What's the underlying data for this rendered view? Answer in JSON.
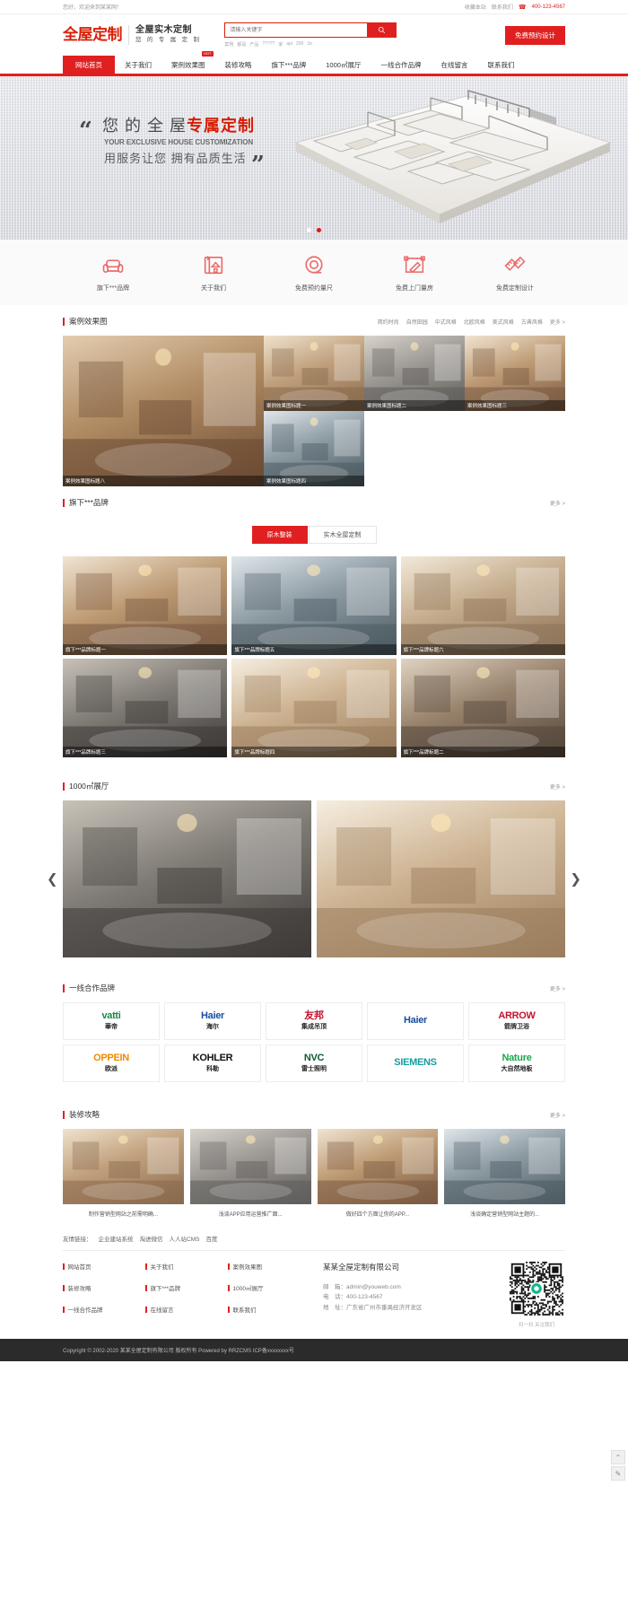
{
  "topbar": {
    "greeting": "您好，欢迎来到某某网！",
    "links": [
      "收藏本站",
      "联系我们"
    ],
    "phone_icon": "telephone-icon",
    "phone": "400-123-4567"
  },
  "header": {
    "logo_mark": "全屋定制",
    "logo_line1": "全屋实木定制",
    "logo_line2": "您 的 专 属 定 制",
    "search_placeholder": "请输入关键字",
    "search_icon": "search-icon",
    "hot_words": [
      "案例",
      "都是",
      "产品",
      "?????",
      "家",
      "api",
      "200",
      "1b"
    ],
    "cta_label": "免费预约设计"
  },
  "nav": {
    "items": [
      {
        "label": "网站首页",
        "active": true,
        "badge": ""
      },
      {
        "label": "关于我们",
        "active": false,
        "badge": ""
      },
      {
        "label": "案例效果图",
        "active": false,
        "badge": "HOT"
      },
      {
        "label": "装修攻略",
        "active": false,
        "badge": ""
      },
      {
        "label": "旗下***品牌",
        "active": false,
        "badge": ""
      },
      {
        "label": "1000㎡展厅",
        "active": false,
        "badge": ""
      },
      {
        "label": "一线合作品牌",
        "active": false,
        "badge": ""
      },
      {
        "label": "在线留言",
        "active": false,
        "badge": ""
      },
      {
        "label": "联系我们",
        "active": false,
        "badge": ""
      }
    ]
  },
  "banner": {
    "quote_open": "“",
    "quote_close": "”",
    "line1_prefix": "您 的 全 屋",
    "line1_accent": "专属定制",
    "line2": "YOUR EXCLUSIVE HOUSE CUSTOMIZATION",
    "line3": "用服务让您 拥有品质生活",
    "dots": [
      false,
      true
    ]
  },
  "features": [
    {
      "icon": "sofa-icon",
      "label": "旗下***品牌"
    },
    {
      "icon": "blueprint-icon",
      "label": "关于我们"
    },
    {
      "icon": "tape-measure-icon",
      "label": "免费预约量尺"
    },
    {
      "icon": "floorplan-ruler-icon",
      "label": "免费上门量房"
    },
    {
      "icon": "pencil-ruler-icon",
      "label": "免费定制设计"
    }
  ],
  "cases": {
    "title": "案例效果图",
    "filters": [
      "简约时尚",
      "自然田园",
      "中式风格",
      "北欧风格",
      "美式风格",
      "古典风格"
    ],
    "more": "更多 >",
    "items": [
      {
        "caption": "案例效果图标题八",
        "big": true
      },
      {
        "caption": "案例效果图标题一",
        "big": false
      },
      {
        "caption": "案例效果图标题二",
        "big": false
      },
      {
        "caption": "案例效果图标题三",
        "big": false
      },
      {
        "caption": "案例效果图标题四",
        "big": false
      }
    ]
  },
  "brands": {
    "title": "旗下***品牌",
    "more": "更多 >",
    "tabs": [
      {
        "label": "原木整装",
        "active": true
      },
      {
        "label": "实木全屋定制",
        "active": false
      }
    ],
    "items": [
      {
        "caption": "旗下***品牌标题一"
      },
      {
        "caption": "旗下***品牌标题五"
      },
      {
        "caption": "旗下***品牌标题六"
      },
      {
        "caption": "旗下***品牌标题三"
      },
      {
        "caption": "旗下***品牌标题四"
      },
      {
        "caption": "旗下***品牌标题二"
      }
    ]
  },
  "showroom": {
    "title": "1000㎡展厅",
    "more": "更多 >",
    "prev_icon": "chevron-left-icon",
    "next_icon": "chevron-right-icon",
    "items": [
      {
        "caption": ""
      },
      {
        "caption": ""
      }
    ]
  },
  "partners": {
    "title": "一线合作品牌",
    "more": "更多 >",
    "logos": [
      {
        "name": "vatti-logo",
        "text": "vatti",
        "sub": "華帝"
      },
      {
        "name": "haier-hairou-logo",
        "text": "Haier",
        "sub": "海尔"
      },
      {
        "name": "youbang-logo",
        "text": "友邦",
        "sub": "集成吊顶"
      },
      {
        "name": "haier-logo",
        "text": "Haier",
        "sub": ""
      },
      {
        "name": "arrow-logo",
        "text": "ARROW",
        "sub": "箭牌卫浴"
      },
      {
        "name": "oppein-logo",
        "text": "OPPEIN",
        "sub": "欧派"
      },
      {
        "name": "kohler-logo",
        "text": "KOHLER",
        "sub": "科勒"
      },
      {
        "name": "nvc-logo",
        "text": "NVC",
        "sub": "雷士照明"
      },
      {
        "name": "siemens-logo",
        "text": "SIEMENS",
        "sub": ""
      },
      {
        "name": "nature-logo",
        "text": "Nature",
        "sub": "大自然地板"
      }
    ]
  },
  "guides": {
    "title": "装修攻略",
    "more": "更多 >",
    "items": [
      {
        "title": "制作营销型网站之前需明确..."
      },
      {
        "title": "浅谈APP应用运营推广面..."
      },
      {
        "title": "做好四个方面让你的APP..."
      },
      {
        "title": "浅谈确定营销型网站主题的..."
      }
    ]
  },
  "friendlinks": {
    "label": "友情链接：",
    "items": [
      "企业建站系统",
      "淘进微信",
      "人人站CMS",
      "百度"
    ]
  },
  "footer": {
    "columns": [
      [
        "网站首页",
        "装修攻略",
        "一线合作品牌"
      ],
      [
        "关于我们",
        "旗下***品牌",
        "在线留言"
      ],
      [
        "案例效果图",
        "1000㎡展厅",
        "联系我们"
      ]
    ],
    "company": "某某全屋定制有限公司",
    "email_label": "邮　箱：",
    "email": "admin@youweb.com",
    "phone_label": "电　话：",
    "phone": "400-123-4567",
    "addr_label": "地　址：",
    "addr": "广东省广州市番禺经济开发区",
    "qr_icon": "qr-code-icon",
    "qr_caption": "扫一扫  关注我们",
    "copyright": "Copyright © 2002-2020 某某全屋定制有限公司 版权所有 Powered by RRZCMS    ICP备xxxxxxxx号"
  },
  "sidetools": [
    {
      "icon": "top-arrow-icon",
      "glyph": "⌃"
    },
    {
      "icon": "service-icon",
      "glyph": "✎"
    }
  ],
  "colors": {
    "brand_red": "#e02020",
    "deep_red": "#d81e06",
    "dark_footer": "#2b2b2b"
  }
}
